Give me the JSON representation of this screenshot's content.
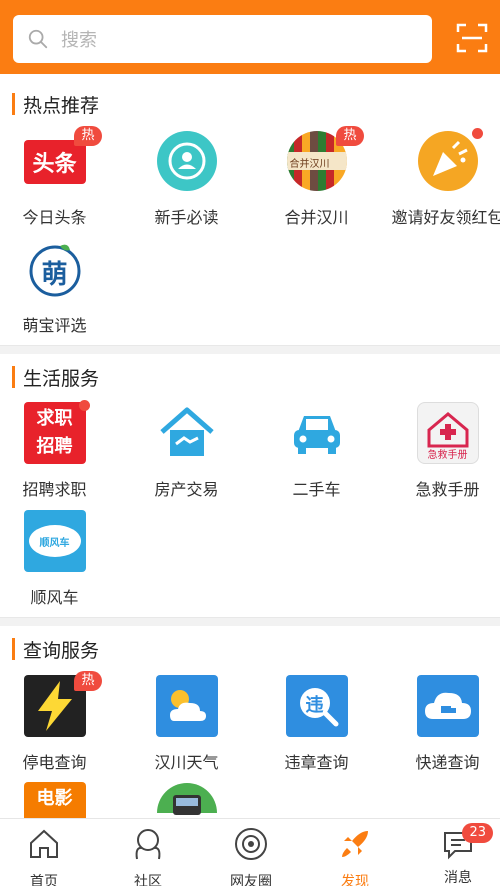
{
  "search": {
    "placeholder": "搜索"
  },
  "sections": [
    {
      "title": "热点推荐",
      "items": [
        {
          "label": "今日头条",
          "icon_text": "头条",
          "badge": "热"
        },
        {
          "label": "新手必读"
        },
        {
          "label": "合并汉川",
          "icon_text": "合并汉川",
          "badge": "热"
        },
        {
          "label": "邀请好友领红包"
        },
        {
          "label": "萌宝评选",
          "icon_text": "萌"
        }
      ]
    },
    {
      "title": "生活服务",
      "items": [
        {
          "label": "招聘求职",
          "icon_text": [
            "求职",
            "招聘"
          ]
        },
        {
          "label": "房产交易"
        },
        {
          "label": "二手车"
        },
        {
          "label": "急救手册",
          "icon_text": "急救手册"
        },
        {
          "label": "顺风车",
          "icon_text": "顺风车"
        }
      ]
    },
    {
      "title": "查询服务",
      "items": [
        {
          "label": "停电查询",
          "badge": "热"
        },
        {
          "label": "汉川天气"
        },
        {
          "label": "违章查询",
          "icon_text": "违"
        },
        {
          "label": "快递查询"
        },
        {
          "label": "",
          "icon_text": "电影"
        }
      ]
    }
  ],
  "tabs": [
    {
      "label": "首页"
    },
    {
      "label": "社区"
    },
    {
      "label": "网友圈"
    },
    {
      "label": "发现",
      "active": true
    },
    {
      "label": "消息",
      "badge": "23"
    }
  ],
  "colors": {
    "accent": "#fb7d12",
    "badge": "#f04b3e"
  }
}
